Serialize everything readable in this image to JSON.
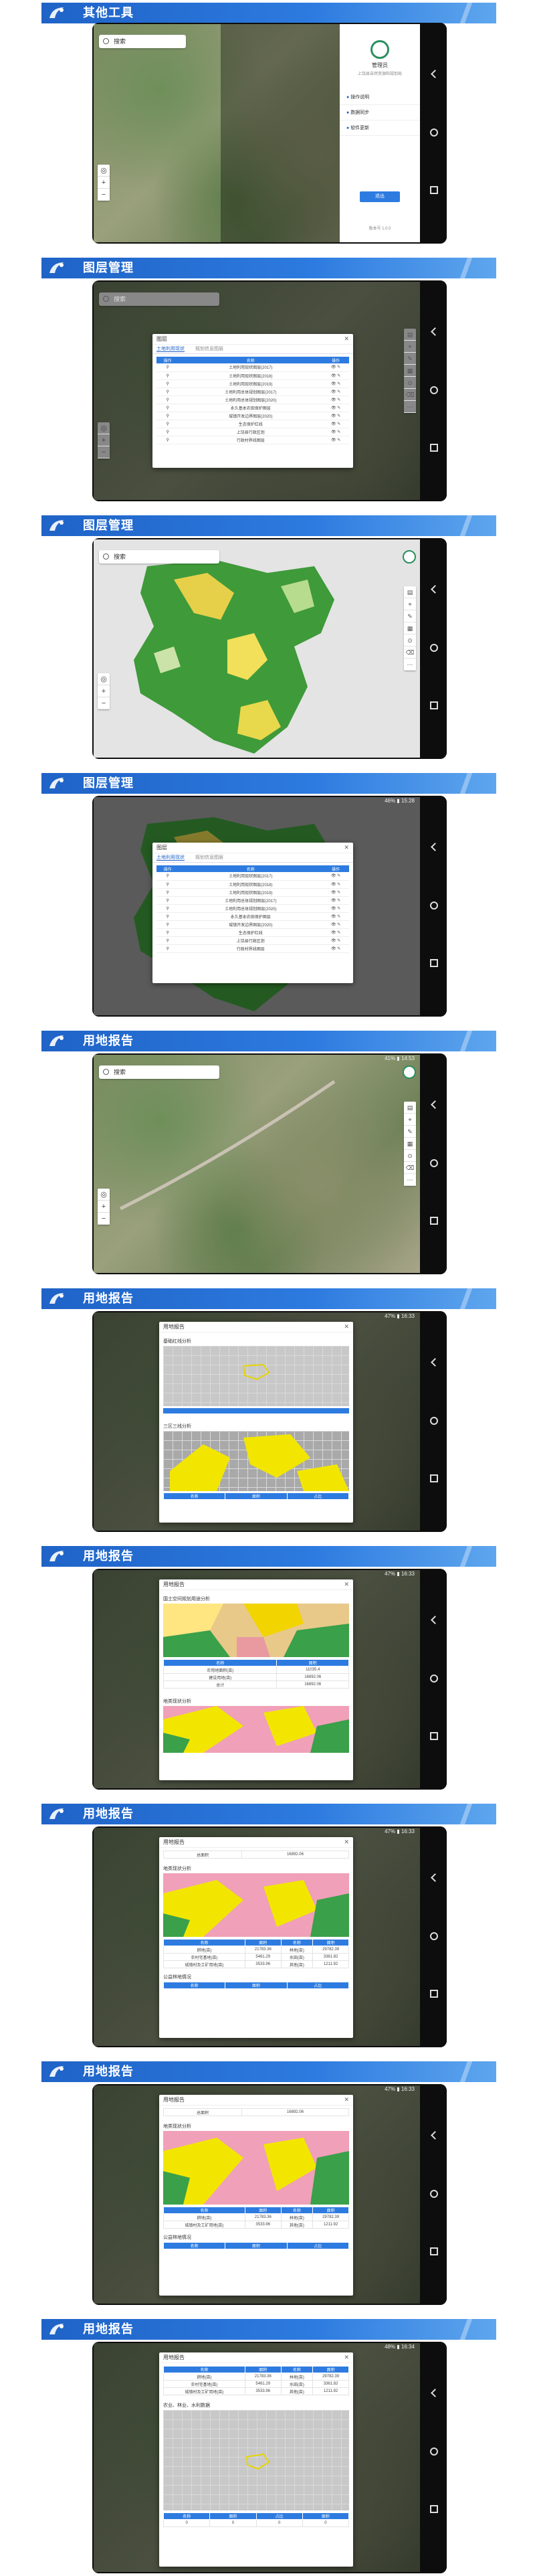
{
  "sections": [
    {
      "title": "其他工具"
    },
    {
      "title": "图层管理"
    },
    {
      "title": "图层管理"
    },
    {
      "title": "图层管理"
    },
    {
      "title": "用地报告"
    },
    {
      "title": "用地报告"
    },
    {
      "title": "用地报告"
    },
    {
      "title": "用地报告"
    },
    {
      "title": "用地报告"
    },
    {
      "title": "用地报告"
    }
  ],
  "status": {
    "s4": "46% ▮ 15:28",
    "s5": "41% ▮ 14:53",
    "s6": "47% ▮ 16:33",
    "s7": "47% ▮ 16:33",
    "s8": "47% ▮ 16:33",
    "s9": "47% ▮ 16:33",
    "s10": "48% ▮ 16:34"
  },
  "search": {
    "placeholder": "搜索"
  },
  "drawer": {
    "user": "管理员",
    "org": "上饶县自然资源和规划局",
    "items": [
      "操作说明",
      "数据同步",
      "软件更新"
    ],
    "logout": "退出",
    "version": "版本号 1.0.0"
  },
  "layer_dialog": {
    "title": "图层",
    "tabs": [
      "土地利用现状",
      "规划信息图层"
    ],
    "headers": [
      "操作",
      "名称",
      "操作"
    ],
    "rows": [
      "土地利用现状图层(2017)",
      "土地利用现状图层(2018)",
      "土地利用现状图层(2019)",
      "土地利用总体规划图层(2017)",
      "土地利用总体规划图层(2020)",
      "永久基本农田保护图层",
      "城镇开发边界图层(2020)",
      "生态保护红线",
      "上饶县行政区划",
      "行政村界线图层"
    ]
  },
  "report": {
    "title": "用地报告",
    "sec_red": "基础红线分析",
    "sec_plan": "三区三线分析",
    "sec_land": "国土空间规划用途分析",
    "sec_present": "地类现状分析",
    "sec_forest": "公益林地情况",
    "sec_farm": "农业、林业、水利数据",
    "col_headers": [
      "名称",
      "面积",
      "占比"
    ],
    "land_rows": [
      {
        "name": "农用地面积(亩)",
        "val": "11035.4"
      },
      {
        "name": "建设用地(亩)",
        "val": "16892.06"
      },
      {
        "name": "总计",
        "val": "16892.06"
      }
    ],
    "present_rows": [
      {
        "a": "耕地(亩)",
        "b": "21783.36",
        "c": "林地(亩)",
        "d": "29782.39"
      },
      {
        "a": "农村宅基地(亩)",
        "b": "5461.29",
        "c": "水田(亩)",
        "d": "3361.82"
      },
      {
        "a": "城镇村及工矿用地(亩)",
        "b": "3533.96",
        "c": "其他(亩)",
        "d": "1211.92"
      }
    ],
    "total_label": "总面积",
    "total_val": "16892.06",
    "forest_headers": [
      "名称",
      "面积",
      "占比"
    ],
    "forest_vals": [
      "0",
      "0",
      "0",
      "0"
    ]
  }
}
